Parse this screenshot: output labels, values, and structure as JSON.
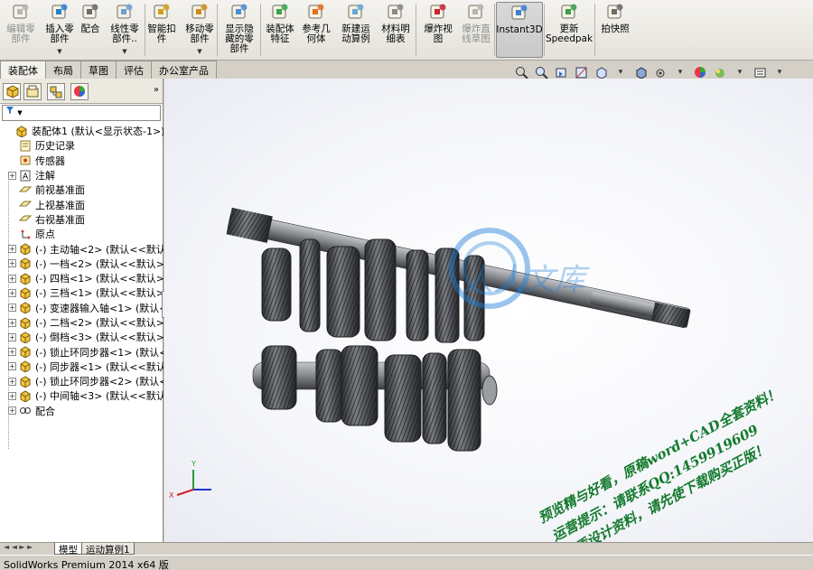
{
  "ribbon": {
    "buttons": [
      {
        "label": "编辑零\n部件",
        "icon": "edit-part-icon",
        "disabled": true
      },
      {
        "label": "插入零\n部件",
        "icon": "insert-component-icon",
        "disabled": false
      },
      {
        "label": "配合",
        "icon": "mate-icon",
        "disabled": false
      },
      {
        "label": "线性零\n部件..",
        "icon": "linear-pattern-icon",
        "disabled": false
      },
      {
        "label": "智能扣\n件",
        "icon": "smart-fastener-icon",
        "disabled": false
      },
      {
        "label": "移动零\n部件",
        "icon": "move-component-icon",
        "disabled": false
      },
      {
        "label": "显示隐\n藏的零\n部件",
        "icon": "show-hidden-icon",
        "disabled": false
      },
      {
        "label": "装配体\n特征",
        "icon": "assembly-feature-icon",
        "disabled": false
      },
      {
        "label": "参考几\n何体",
        "icon": "reference-geometry-icon",
        "disabled": false
      },
      {
        "label": "新建运\n动算例",
        "icon": "motion-study-icon",
        "disabled": false
      },
      {
        "label": "材料明\n细表",
        "icon": "bom-icon",
        "disabled": false
      },
      {
        "label": "爆炸视\n图",
        "icon": "exploded-view-icon",
        "disabled": false
      },
      {
        "label": "爆炸直\n线草图",
        "icon": "explode-line-icon",
        "disabled": true
      },
      {
        "label": "Instant3D",
        "icon": "instant3d-icon",
        "disabled": false
      },
      {
        "label": "更新\nSpeedpak",
        "icon": "speedpak-icon",
        "disabled": false
      },
      {
        "label": "拍快照",
        "icon": "snapshot-icon",
        "disabled": false
      }
    ]
  },
  "tabs": [
    "装配体",
    "布局",
    "草图",
    "评估",
    "办公室产品"
  ],
  "filter_symbol": "▼",
  "tree": {
    "root": "装配体1  (默认<显示状态-1>)",
    "items": [
      {
        "label": "历史记录",
        "icon": "history-icon",
        "expandable": false
      },
      {
        "label": "传感器",
        "icon": "sensor-icon",
        "expandable": false
      },
      {
        "label": "注解",
        "icon": "annotation-icon",
        "expandable": true
      },
      {
        "label": "前视基准面",
        "icon": "plane-icon",
        "expandable": false
      },
      {
        "label": "上视基准面",
        "icon": "plane-icon",
        "expandable": false
      },
      {
        "label": "右视基准面",
        "icon": "plane-icon",
        "expandable": false
      },
      {
        "label": "原点",
        "icon": "origin-icon",
        "expandable": false
      },
      {
        "label": "(-) 主动轴<2> (默认<<默认>_",
        "icon": "part-icon",
        "expandable": true
      },
      {
        "label": "(-) 一档<2> (默认<<默认>_",
        "icon": "part-icon",
        "expandable": true
      },
      {
        "label": "(-) 四档<1> (默认<<默认>_",
        "icon": "part-icon",
        "expandable": true
      },
      {
        "label": "(-) 三档<1> (默认<<默认>_",
        "icon": "part-icon",
        "expandable": true
      },
      {
        "label": "(-) 变速器输入轴<1> (默认<",
        "icon": "part-icon",
        "expandable": true
      },
      {
        "label": "(-) 二档<2> (默认<<默认>_",
        "icon": "part-icon",
        "expandable": true
      },
      {
        "label": "(-) 倒档<3> (默认<<默认>_",
        "icon": "part-icon",
        "expandable": true
      },
      {
        "label": "(-) 锁止环同步器<1> (默认<",
        "icon": "part-icon",
        "expandable": true
      },
      {
        "label": "(-) 同步器<1> (默认<<默认>",
        "icon": "part-icon",
        "expandable": true
      },
      {
        "label": "(-) 锁止环同步器<2> (默认<",
        "icon": "part-icon",
        "expandable": true
      },
      {
        "label": "(-) 中间轴<3> (默认<<默认>",
        "icon": "part-icon",
        "expandable": true
      },
      {
        "label": "配合",
        "icon": "mates-folder-icon",
        "expandable": true
      }
    ]
  },
  "bottom_tabs": [
    "模型",
    "运动算例1"
  ],
  "status": "SolidWorks Premium 2014 x64 版",
  "watermark_text": "人人文库",
  "stamp": {
    "line1": "预览精与好看，原稿word+CAD全套资料！",
    "line2": "运营提示：请联系QQ:1459919609",
    "line3": "优质设计资料，请先使下载购买正版！"
  },
  "colors": {
    "stamp": "#147a2e",
    "gear": "#4a4d52",
    "accent": "#2a6fd1"
  }
}
